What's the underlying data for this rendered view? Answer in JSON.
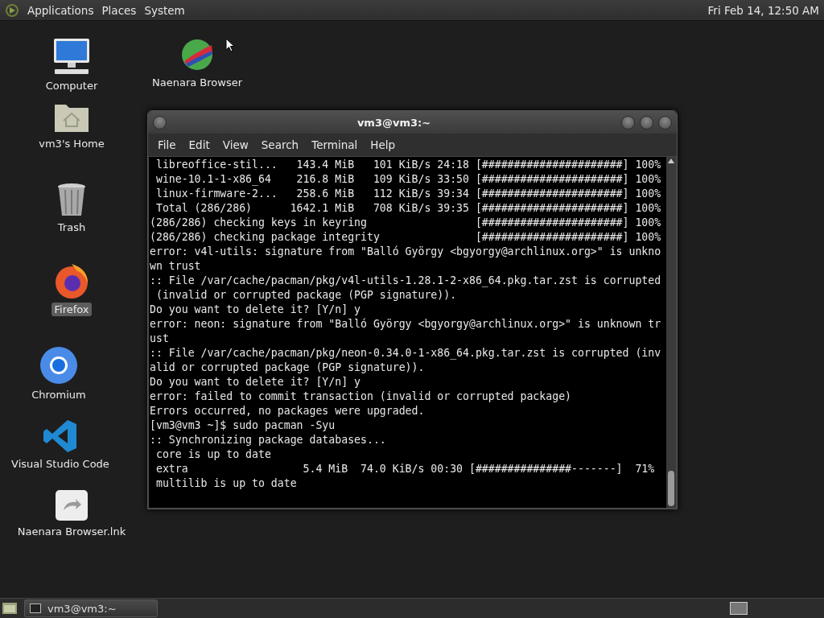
{
  "top_panel": {
    "menus": [
      "Applications",
      "Places",
      "System"
    ],
    "clock": "Fri Feb 14, 12:50 AM"
  },
  "desktop_icons": [
    {
      "kind": "computer",
      "label": "Computer",
      "selected": false
    },
    {
      "kind": "globe",
      "label": "Naenara Browser",
      "selected": false
    },
    {
      "kind": "home",
      "label": "vm3's Home",
      "selected": false
    },
    {
      "kind": "trash",
      "label": "Trash",
      "selected": false
    },
    {
      "kind": "firefox",
      "label": "Firefox",
      "selected": true
    },
    {
      "kind": "chromium",
      "label": "Chromium",
      "selected": false
    },
    {
      "kind": "vscode",
      "label": "Visual Studio Code",
      "selected": false
    },
    {
      "kind": "link",
      "label": "Naenara Browser.lnk",
      "selected": false
    }
  ],
  "terminal": {
    "title": "vm3@vm3:~",
    "menus": [
      "File",
      "Edit",
      "View",
      "Search",
      "Terminal",
      "Help"
    ],
    "lines": [
      " libreoffice-stil...   143.4 MiB   101 KiB/s 24:18 [######################] 100%",
      " wine-10.1-1-x86_64    216.8 MiB   109 KiB/s 33:50 [######################] 100%",
      " linux-firmware-2...   258.6 MiB   112 KiB/s 39:34 [######################] 100%",
      " Total (286/286)      1642.1 MiB   708 KiB/s 39:35 [######################] 100%",
      "(286/286) checking keys in keyring                 [######################] 100%",
      "(286/286) checking package integrity               [######################] 100%",
      "error: v4l-utils: signature from \"Balló György <bgyorgy@archlinux.org>\" is unkno",
      "wn trust",
      ":: File /var/cache/pacman/pkg/v4l-utils-1.28.1-2-x86_64.pkg.tar.zst is corrupted",
      " (invalid or corrupted package (PGP signature)).",
      "Do you want to delete it? [Y/n] y",
      "error: neon: signature from \"Balló György <bgyorgy@archlinux.org>\" is unknown tr",
      "ust",
      ":: File /var/cache/pacman/pkg/neon-0.34.0-1-x86_64.pkg.tar.zst is corrupted (inv",
      "alid or corrupted package (PGP signature)).",
      "Do you want to delete it? [Y/n] y",
      "error: failed to commit transaction (invalid or corrupted package)",
      "Errors occurred, no packages were upgraded.",
      "[vm3@vm3 ~]$ sudo pacman -Syu",
      ":: Synchronizing package databases...",
      " core is up to date",
      " extra                  5.4 MiB  74.0 KiB/s 00:30 [###############-------]  71%",
      " multilib is up to date"
    ]
  },
  "taskbar": {
    "tasks": [
      {
        "label": "vm3@vm3:~",
        "selected": false
      }
    ]
  }
}
